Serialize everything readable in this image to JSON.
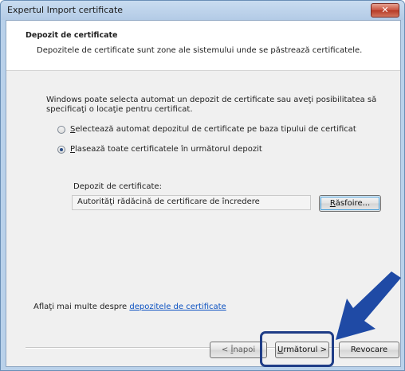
{
  "window": {
    "title": "Expertul Import certificate",
    "close_glyph": "✕"
  },
  "header": {
    "title": "Depozit de certificate",
    "subtitle": "Depozitele de certificate sunt zone ale sistemului unde se păstrează certificatele."
  },
  "body": {
    "description": "Windows poate selecta automat un depozit de certificate sau aveţi posibilitatea să specificaţi o locaţie pentru certificat.",
    "radio_auto": {
      "accel": "S",
      "label_rest": "electează automat depozitul de certificate pe baza tipului de certificat",
      "selected": false
    },
    "radio_place": {
      "accel": "P",
      "label_rest": "lasează toate certificatele în următorul depozit",
      "selected": true
    },
    "store_label": "Depozit de certificate:",
    "store_value": "Autorităţi rădăcină de certificare de încredere",
    "browse": {
      "accel": "R",
      "label_rest": "ăsfoire..."
    }
  },
  "footer": {
    "learn_prefix": "Aflaţi mai multe despre",
    "learn_link": "depozitele de certificate",
    "back": {
      "prefix": "< ",
      "accel": "Î",
      "label_rest": "napoi"
    },
    "next": {
      "accel": "U",
      "label_rest": "rmătorul >"
    },
    "cancel": "Revocare"
  },
  "colors": {
    "highlight": "#1f3d87",
    "arrow": "#1f4aa5",
    "link": "#0b51c1"
  },
  "icons": {
    "close": "close-icon",
    "pointer": "pointer-arrow-icon"
  }
}
